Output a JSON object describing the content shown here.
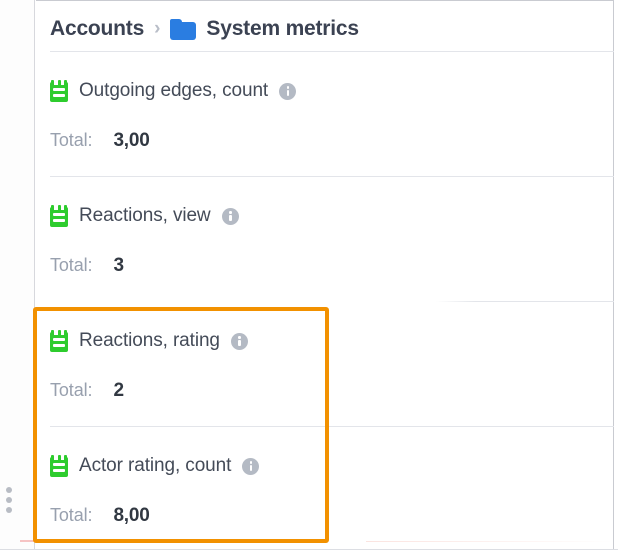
{
  "breadcrumb": {
    "root_label": "Accounts",
    "separator": "›",
    "folder_icon": "folder-icon",
    "current_label": "System metrics"
  },
  "metrics": [
    {
      "icon": "green-list-icon",
      "label": "Outgoing edges, count",
      "info_icon": "info-icon",
      "total_label": "Total:",
      "total_value": "3,00",
      "highlighted": false
    },
    {
      "icon": "green-list-icon",
      "label": "Reactions, view",
      "info_icon": "info-icon",
      "total_label": "Total:",
      "total_value": "3",
      "highlighted": false
    },
    {
      "icon": "green-list-icon",
      "label": "Reactions, rating",
      "info_icon": "info-icon",
      "total_label": "Total:",
      "total_value": "2",
      "highlighted": true
    },
    {
      "icon": "green-list-icon",
      "label": "Actor rating, count",
      "info_icon": "info-icon",
      "total_label": "Total:",
      "total_value": "8,00",
      "highlighted": true
    }
  ],
  "drag_handle": {
    "icon": "drag-handle-icon"
  },
  "colors": {
    "highlight_orange": "#f29100",
    "metric_icon_green": "#2ecc2e",
    "folder_blue": "#2a7de1",
    "info_gray": "#b4bac4",
    "text_dark": "#3b4252",
    "text_muted": "#98a0ae",
    "divider": "#e3e5ea"
  }
}
